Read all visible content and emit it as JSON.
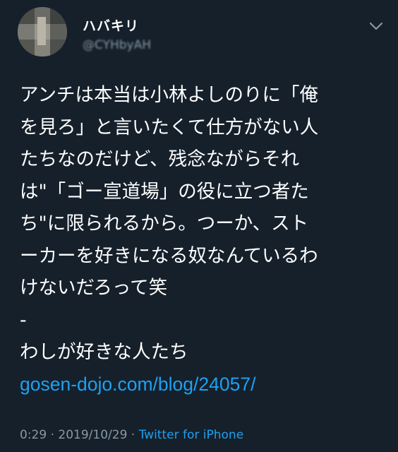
{
  "tweet": {
    "author": {
      "display_name": "ハバキリ",
      "handle": "@CYHbyAH"
    },
    "text_lines": [
      "アンチは本当は小林よしのりに「俺",
      "を見ろ」と言いたくて仕方がない人",
      "たちなのだけど、残念ながらそれ",
      "は\"「ゴー宣道場」の役に立つ者た",
      "ち\"に限られるから。つーか、スト",
      "ーカーを好きになる奴なんているわ",
      "けないだろって笑",
      "-",
      "わしが好きな人たち"
    ],
    "link": "gosen-dojo.com/blog/24057/",
    "time": "0:29",
    "date": "2019/10/29",
    "separator": "·",
    "source": "Twitter for iPhone"
  },
  "icons": {
    "menu": "chevron-down-icon"
  },
  "colors": {
    "background": "#15202b",
    "text": "#ffffff",
    "secondary": "#8899a6",
    "link": "#1da1f2"
  }
}
